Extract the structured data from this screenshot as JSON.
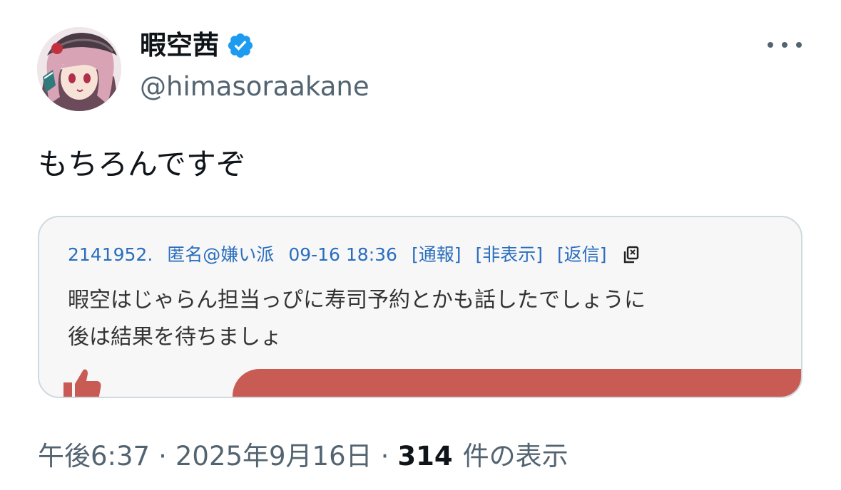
{
  "author": {
    "display_name": "暇空茜",
    "handle": "@himasoraakane",
    "avatar_icon": "anime-avatar-icon",
    "verified_icon": "verified-badge-icon"
  },
  "tweet": {
    "text": "もちろんですぞ"
  },
  "embedded_post": {
    "post_number": "2141952.",
    "author": "匿名@嫌い派",
    "datetime": "09-16 18:36",
    "actions": [
      "[通報]",
      "[非表示]",
      "[返信]"
    ],
    "copy_icon": "copy-icon",
    "body_lines": [
      "暇空はじゃらん担当っぴに寿司予約とかも話したでしょうに",
      "後は結果を待ちましょ"
    ],
    "thumb_icon": "thumbs-up-icon"
  },
  "meta": {
    "time": "午後6:37",
    "separator": "·",
    "date": "2025年9月16日",
    "views_count": "314",
    "views_label": "件の表示"
  },
  "colors": {
    "text_primary": "#0f1419",
    "text_secondary": "#536471",
    "verified_blue": "#1d9bf0",
    "link_blue": "#2a6ebd",
    "vote_bar_red": "#c85c55",
    "card_border": "#cfd9de"
  }
}
